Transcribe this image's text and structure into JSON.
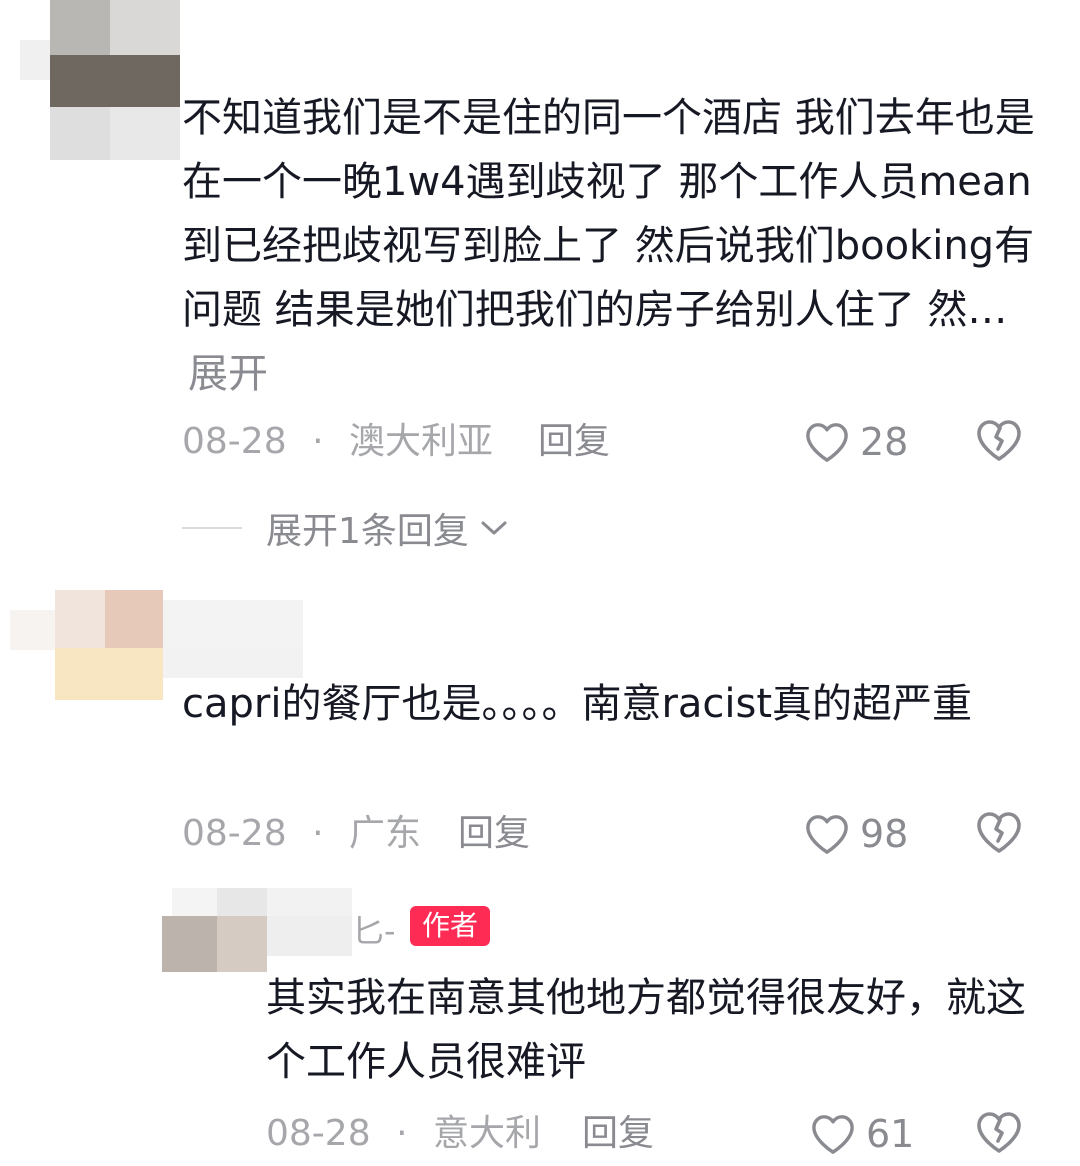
{
  "comments": [
    {
      "text": "不知道我们是不是住的同一个酒店 我们去年也是在一个一晚1w4遇到歧视了 那个工作人员mean到已经把歧视写到脸上了 然后说我们booking有问题 结果是她们把我们的房子给别人住了 然…",
      "expand_label": "展开",
      "date": "08-28",
      "separator": "·",
      "location": "澳大利亚",
      "reply_label": "回复",
      "likes": "28",
      "expand_replies_label": "展开1条回复"
    },
    {
      "text": "capri的餐厅也是。。。。南意racist真的超严重",
      "date": "08-28",
      "separator": "·",
      "location": "广东",
      "reply_label": "回复",
      "likes": "98"
    }
  ],
  "reply": {
    "username_fragment": "匕-",
    "author_badge": "作者",
    "text": "其实我在南意其他地方都觉得很友好，就这个工作人员很难评",
    "date": "08-28",
    "separator": "·",
    "location": "意大利",
    "reply_label": "回复",
    "likes": "61"
  },
  "colors": {
    "text_primary": "#161823",
    "text_secondary": "#8a8b91",
    "text_meta": "#a6a7ab",
    "author_badge_bg": "#fe2c55"
  },
  "icons": [
    "heart-icon",
    "broken-heart-icon",
    "chevron-down-icon"
  ]
}
